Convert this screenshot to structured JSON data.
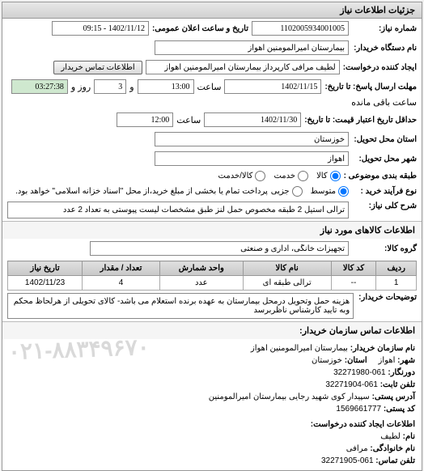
{
  "panel_title": "جزئیات اطلاعات نیاز",
  "fields": {
    "request_number_label": "شماره نیاز:",
    "request_number": "1102005934001005",
    "announce_label": "تاریخ و ساعت اعلان عمومی:",
    "announce_value": "1402/11/12 - 09:15",
    "buyer_org_label": "نام دستگاه خریدار:",
    "buyer_org": "بیمارستان امیرالمومنین اهواز",
    "requester_label": "ایجاد کننده درخواست:",
    "requester": "لطیف مرافی کارپرداز بیمارستان امیرالمومنین اهواز",
    "contact_btn": "اطلاعات تماس خریدار",
    "deadline_label": "مهلت ارسال پاسخ: تا تاریخ:",
    "deadline_date": "1402/11/15",
    "time_label1": "ساعت",
    "deadline_time": "13:00",
    "and_label": "و",
    "remaining_days": "3",
    "day_label": "روز و",
    "remaining_time": "03:27:38",
    "remain_label": "ساعت باقی مانده",
    "expiry_label": "حداقل تاریخ اعتبار قیمت: تا تاریخ:",
    "expiry_date": "1402/11/30",
    "time_label2": "ساعت",
    "expiry_time": "12:00",
    "province_label": "استان محل تحویل:",
    "province": "خوزستان",
    "city_label": "شهر محل تحویل:",
    "city": "اهواز",
    "category_label": "طبقه بندی موضوعی :",
    "opt_goods": "کالا",
    "opt_service": "خدمت",
    "opt_goods_service": "کالا/خدمت",
    "purchase_type_label": "نوع فرآیند خرید :",
    "opt_medium": "متوسط",
    "purchase_note": "پرداخت تمام یا بخشی از مبلغ خرید،از محل \"اسناد خزانه اسلامی\" خواهد بود.",
    "opt_minor": "جزیی"
  },
  "general_desc_label": "شرح کلی نیاز:",
  "general_desc": "ترالی استیل 2 طبقه مخصوص حمل لنز طبق مشخصات لیست پیوستی به تعداد 2 عدد",
  "goods_section_title": "اطلاعات کالاهای مورد نیاز",
  "goods_group_label": "گروه کالا:",
  "goods_group": "تجهیزات خانگی، اداری و صنعتی",
  "table": {
    "headers": [
      "ردیف",
      "کد کالا",
      "نام کالا",
      "واحد شمارش",
      "تعداد / مقدار",
      "تاریخ نیاز"
    ],
    "rows": [
      {
        "idx": "1",
        "code": "--",
        "name": "ترالی طبقه ای",
        "unit": "عدد",
        "qty": "4",
        "date": "1402/11/23"
      }
    ]
  },
  "buyer_notes_label": "توضیحات خریدار:",
  "buyer_notes": "هزینه حمل وتحویل درمحل بیمارستان به عهده برنده استعلام می باشد- کالای تحویلی از هرلحاظ محکم وبه تایید کارشناس ناظربرسد",
  "contact_section_title": "اطلاعات تماس سازمان خریدار:",
  "contact": {
    "org_label": "نام سازمان خریدار:",
    "org": "بیمارستان امیرالمومنین اهواز",
    "city_label": "شهر:",
    "city": "اهواز",
    "province_label": "استان:",
    "province": "خوزستان",
    "fax_label": "دورنگار:",
    "fax": "061-32271980",
    "phone_label": "تلفن ثابت:",
    "phone": "061-32271904",
    "address_label": "آدرس پستی:",
    "address": "سپیدار کوی شهید رجایی بیمارستان امیرالمومنین",
    "postal_label": "کد پستی:",
    "postal": "1569661777",
    "requester_section": "اطلاعات ایجاد کننده درخواست:",
    "name_label": "نام:",
    "name": "لطيف",
    "surname_label": "نام خانوادگی:",
    "surname": "مرافی",
    "req_phone_label": "تلفن تماس:",
    "req_phone": "061-32271905"
  },
  "watermark": "۰۲۱-۸۸۳۴۹۶۷۰"
}
